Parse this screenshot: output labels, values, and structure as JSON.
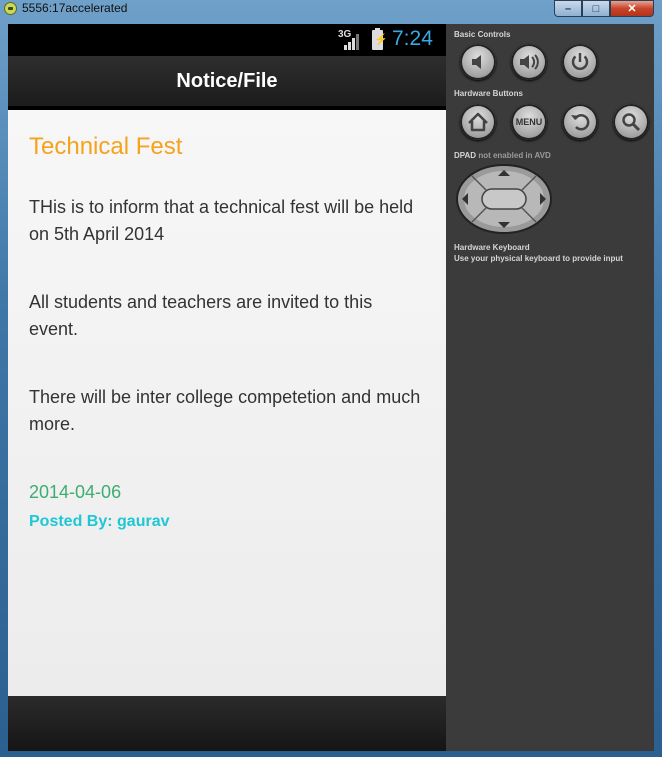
{
  "window": {
    "title": "5556:17accelerated",
    "min_label": "–",
    "max_label": "□",
    "close_label": "✕"
  },
  "statusbar": {
    "network": "3G",
    "time": "7:24"
  },
  "actionbar": {
    "title": "Notice/File"
  },
  "notice": {
    "title": "Technical Fest",
    "paragraphs": [
      "THis is to inform that a technical fest will be held on 5th April 2014",
      "All students and teachers are invited to this event.",
      "There will be inter college competetion and much more."
    ],
    "date": "2014-04-06",
    "posted_by": "Posted By: gaurav"
  },
  "panel": {
    "basic_controls": "Basic Controls",
    "hardware_buttons": "Hardware Buttons",
    "menu_label": "MENU",
    "dpad_label": "DPAD",
    "dpad_note": "not enabled in AVD",
    "keyboard_title": "Hardware Keyboard",
    "keyboard_note": "Use your physical keyboard to provide input"
  },
  "colors": {
    "heading": "#f5a21c",
    "date": "#3cae6f",
    "posted": "#1fc7d4",
    "clock": "#38a9e6"
  }
}
